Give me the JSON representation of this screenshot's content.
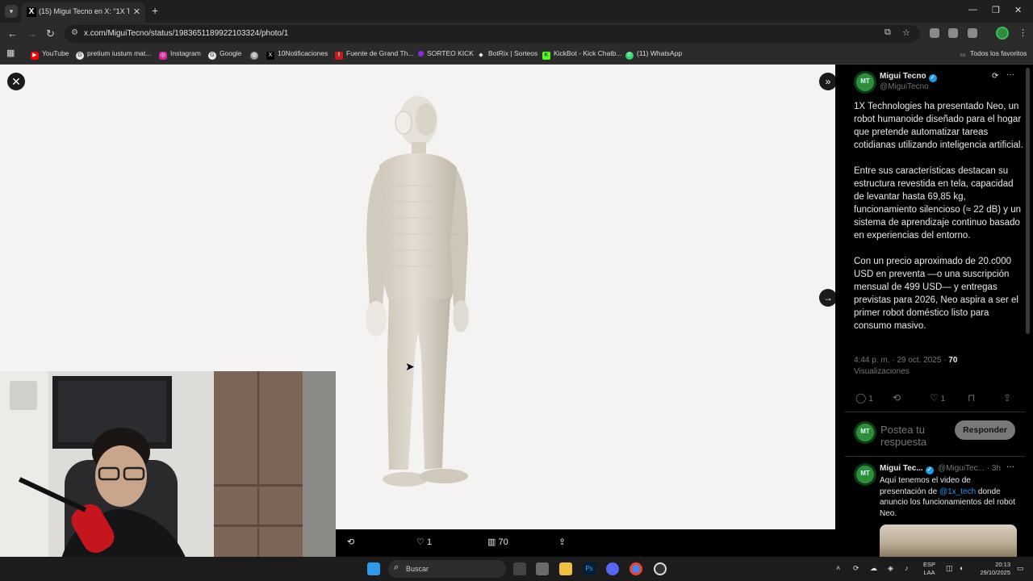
{
  "browser": {
    "tab_title": "(15) Migui Tecno en X: \"1X Tech",
    "url": "x.com/MiguiTecno/status/1983651189922103324/photo/1",
    "bookmarks": [
      {
        "label": "YouTube",
        "icon": "youtube-icon",
        "color": "#ff0000"
      },
      {
        "label": "pretium iustum mat...",
        "icon": "google-icon",
        "color": "#e8e8e8"
      },
      {
        "label": "Instagram",
        "icon": "instagram-icon",
        "color": "#d6249f"
      },
      {
        "label": "Google",
        "icon": "google-icon",
        "color": "#e8e8e8"
      },
      {
        "label": "",
        "icon": "globe-icon",
        "color": "#9a9a9a"
      },
      {
        "label": "10Notificaciones",
        "icon": "x-icon",
        "color": "#000000"
      },
      {
        "label": "Fuente de Grand Th...",
        "icon": "f-icon",
        "color": "#c21c1c"
      },
      {
        "label": "SORTEO KICK",
        "icon": "kick-icon",
        "color": "#8a2be2"
      },
      {
        "label": "BotRix | Sorteos",
        "icon": "diamond-icon",
        "color": "#e8e8e8"
      },
      {
        "label": "KickBot - Kick Chatb...",
        "icon": "kickbot-icon",
        "color": "#53fc18"
      },
      {
        "label": "(11) WhatsApp",
        "icon": "whatsapp-icon",
        "color": "#25d366"
      }
    ],
    "all_bookmarks": "Todos los favoritos"
  },
  "media_actions": {
    "likes": "1",
    "views": "70"
  },
  "tweet": {
    "author": "Migui Tecno",
    "handle": "@MiguiTecno",
    "paragraphs": [
      "1X Technologies ha presentado Neo, un robot humanoide diseñado para el hogar que pretende automatizar tareas cotidianas utilizando inteligencia artificial.",
      "Entre sus características destacan su estructura revestida en tela, capacidad de levantar hasta 69,85 kg, funcionamiento silencioso (≈ 22 dB) y un sistema de aprendizaje continuo basado en experiencias del entorno.",
      "Con un precio aproximado de 20.c000 USD en preventa —o una suscripción mensual de 499 USD— y entregas previstas para 2026, Neo aspira a ser el primer robot doméstico listo para consumo masivo."
    ],
    "timestamp": "4:44 p. m. · 29 oct. 2025 · ",
    "views_count": "70",
    "views_label": "Visualizaciones",
    "reply_count": "1",
    "like_count": "1",
    "avatar_initials": "MT"
  },
  "reply_box": {
    "placeholder": "Postea tu respuesta",
    "button": "Responder"
  },
  "reply": {
    "author": "Migui Tec...",
    "handle": "@MiguiTec...",
    "time": "· 3h",
    "text_before": "Aquí tenemos el video de presentación de ",
    "mention": "@1x_tech",
    "text_after": " donde anuncio los funcionamientos del robot Neo."
  },
  "taskbar": {
    "search": "Buscar",
    "lang_1": "ESP",
    "lang_2": "LAA",
    "time": "20:13",
    "date": "29/10/2025"
  },
  "colors": {
    "accent": "#1d9bf0",
    "background_dark": "#000000",
    "viewer_bg": "#f4f3f1"
  }
}
